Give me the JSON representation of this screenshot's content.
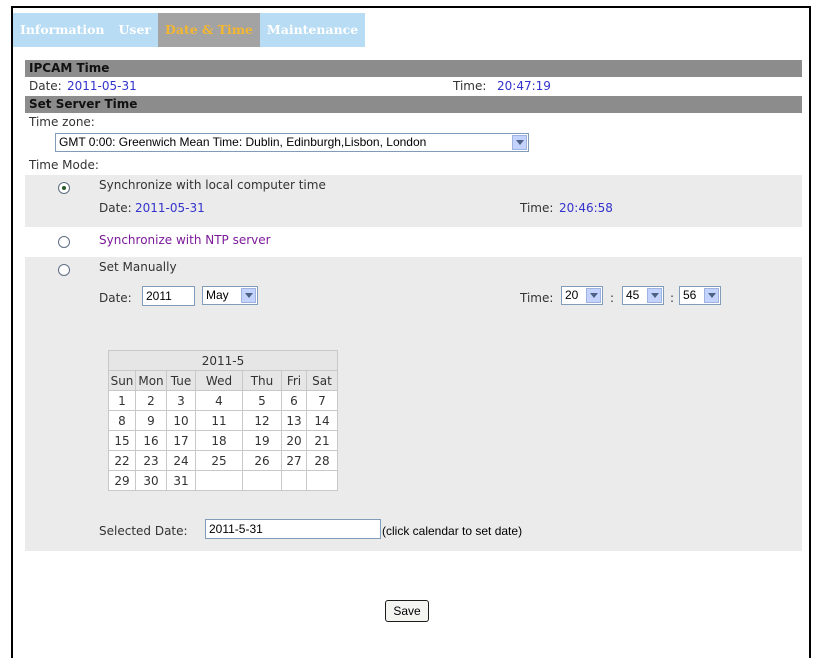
{
  "tabs": [
    {
      "label": "Information",
      "active": false
    },
    {
      "label": "User",
      "active": false
    },
    {
      "label": "Date & Time",
      "active": true
    },
    {
      "label": "Maintenance",
      "active": false
    }
  ],
  "ipcam_time": {
    "header": "IPCAM Time",
    "date_label": "Date:",
    "date_value": "2011-05-31",
    "time_label": "Time:",
    "time_value": "20:47:19"
  },
  "server_time": {
    "header": "Set Server Time",
    "timezone_label": "Time zone:",
    "timezone_value": "GMT 0:00: Greenwich Mean Time: Dublin, Edinburgh,Lisbon, London",
    "time_mode_label": "Time Mode:",
    "options": {
      "local": {
        "label": "Synchronize with local computer time",
        "selected": true,
        "date_label": "Date:",
        "date_value": "2011-05-31",
        "time_label": "Time:",
        "time_value": "20:46:58"
      },
      "ntp": {
        "label": "Synchronize with NTP server",
        "selected": false
      },
      "manual": {
        "label": "Set Manually",
        "selected": false,
        "date_label": "Date:",
        "year_value": "2011",
        "month_value": "May",
        "time_label": "Time:",
        "hour_value": "20",
        "minute_value": "45",
        "second_value": "56",
        "sep": ":"
      }
    },
    "calendar": {
      "title": "2011-5",
      "weekdays": [
        "Sun",
        "Mon",
        "Tue",
        "Wed",
        "Thu",
        "Fri",
        "Sat"
      ],
      "weeks": [
        [
          "1",
          "2",
          "3",
          "4",
          "5",
          "6",
          "7"
        ],
        [
          "8",
          "9",
          "10",
          "11",
          "12",
          "13",
          "14"
        ],
        [
          "15",
          "16",
          "17",
          "18",
          "19",
          "20",
          "21"
        ],
        [
          "22",
          "23",
          "24",
          "25",
          "26",
          "27",
          "28"
        ],
        [
          "29",
          "30",
          "31",
          "",
          "",
          "",
          ""
        ]
      ]
    },
    "selected_date_label": "Selected Date:",
    "selected_date_value": "2011-5-31",
    "selected_date_hint": "(click calendar to set date)",
    "save_label": "Save"
  },
  "colors": {
    "tab_bg": "#b8dcf4",
    "tab_active_bg": "#a3a3a3",
    "tab_active_text": "#f5b730",
    "section_bar": "#8c8c8c",
    "value_blue": "#3333cc",
    "link_purple": "#7c1a9a",
    "panel_grey": "#ebebeb"
  }
}
